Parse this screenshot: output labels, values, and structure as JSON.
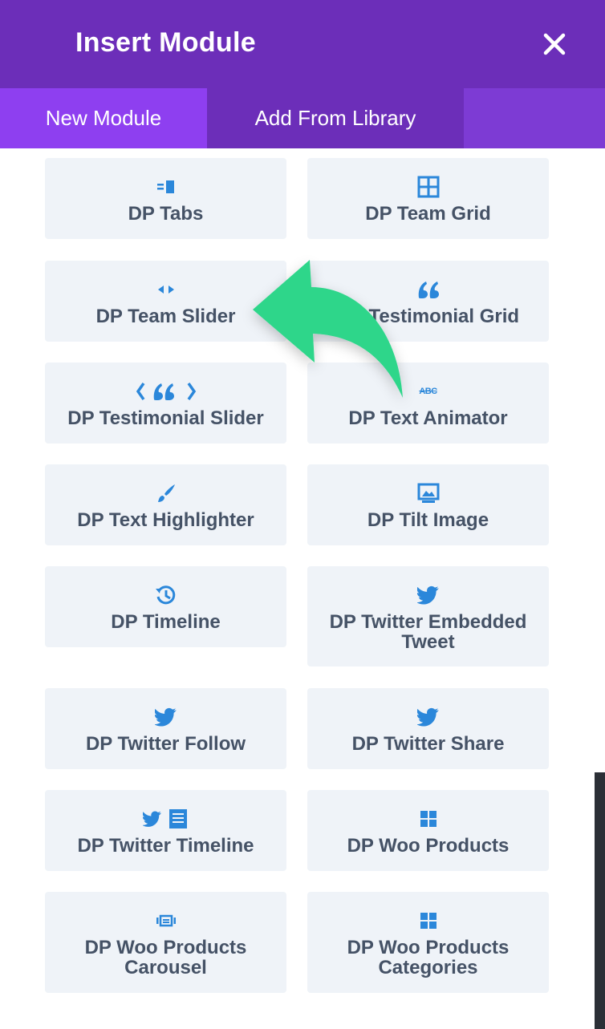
{
  "header": {
    "title": "Insert Module",
    "close_icon": "close-icon"
  },
  "tabs": [
    {
      "label": "New Module",
      "active": true
    },
    {
      "label": "Add From Library",
      "active": false
    }
  ],
  "colors": {
    "header": "#6c2eb9",
    "tab_active": "#8e3ff0",
    "card_bg": "#eff3f8",
    "icon_blue": "#2b87da",
    "arrow_green": "#2dd68a"
  },
  "modules": [
    {
      "label": "DP Tabs",
      "icon": "tabs-icon"
    },
    {
      "label": "DP Team Grid",
      "icon": "grid-icon"
    },
    {
      "label": "DP Team Slider",
      "icon": "slider-arrows-icon"
    },
    {
      "label": "DP Testimonial Grid",
      "icon": "quote-icon"
    },
    {
      "label": "DP Testimonial Slider",
      "icon": "quote-slider-icon"
    },
    {
      "label": "DP Text Animator",
      "icon": "strikethrough-text-icon"
    },
    {
      "label": "DP Text Highlighter",
      "icon": "brush-icon"
    },
    {
      "label": "DP Tilt Image",
      "icon": "image-icon"
    },
    {
      "label": "DP Timeline",
      "icon": "history-icon"
    },
    {
      "label": "DP Twitter Embedded Tweet",
      "icon": "twitter-icon"
    },
    {
      "label": "DP Twitter Follow",
      "icon": "twitter-icon"
    },
    {
      "label": "DP Twitter Share",
      "icon": "twitter-icon"
    },
    {
      "label": "DP Twitter Timeline",
      "icon": "twitter-document-icon"
    },
    {
      "label": "DP Woo Products",
      "icon": "grid-squares-icon"
    },
    {
      "label": "DP Woo Products Carousel",
      "icon": "carousel-icon"
    },
    {
      "label": "DP Woo Products Categories",
      "icon": "grid-squares-icon"
    }
  ],
  "icon_text": {
    "abc": "ABC"
  }
}
